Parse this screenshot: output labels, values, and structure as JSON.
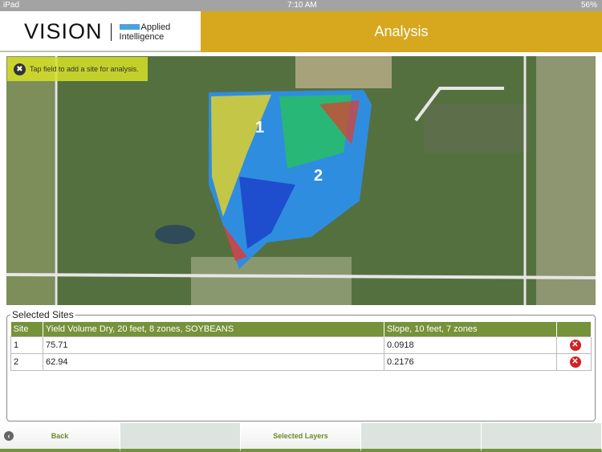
{
  "status": {
    "device": "iPad",
    "time": "7:10 AM",
    "battery": "56%"
  },
  "header": {
    "brand": "VISION",
    "partner_line1": "Applied",
    "partner_line2": "Intelligence",
    "title": "Analysis"
  },
  "map": {
    "tip": "Tap field to add a site for analysis.",
    "sites": [
      "1",
      "2"
    ]
  },
  "selected": {
    "legend": "Selected Sites",
    "columns": [
      "Site",
      "Yield Volume Dry, 20 feet, 8 zones, SOYBEANS",
      "Slope, 10 feet, 7 zones"
    ],
    "rows": [
      {
        "site": "1",
        "yield": "75.71",
        "slope": "0.0918"
      },
      {
        "site": "2",
        "yield": "62.94",
        "slope": "0.2176"
      }
    ]
  },
  "footer": {
    "back": "Back",
    "layers": "Selected Layers"
  }
}
